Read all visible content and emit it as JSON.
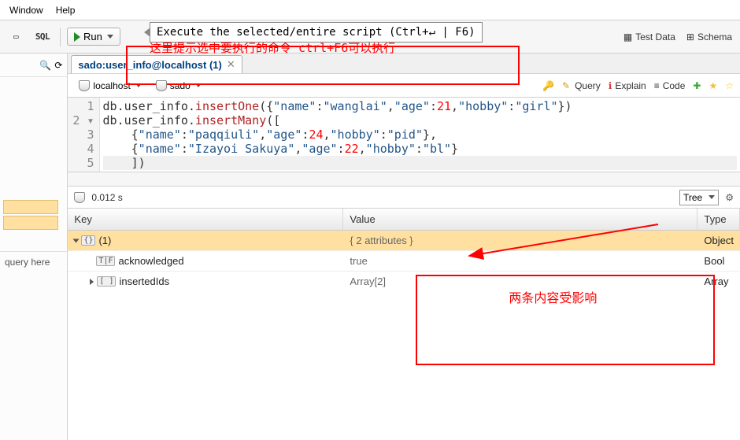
{
  "menu": {
    "window": "Window",
    "help": "Help"
  },
  "toolbar": {
    "run": "Run",
    "tooltip": "Execute the selected/entire script (Ctrl+↵ | F6)",
    "hint_cn": "这里提示选中要执行的命令 ctrl+F6可以执行",
    "test_data": "Test Data",
    "schema": "Schema"
  },
  "tab": {
    "title": "sado:user_info@localhost (1)"
  },
  "conn": {
    "host": "localhost",
    "db": "sado",
    "query": "Query",
    "explain": "Explain",
    "code": "Code"
  },
  "editor": {
    "l1": "db.user_info.insertOne({\"name\":\"wanglai\",\"age\":21,\"hobby\":\"girl\"})",
    "l2a": "db.user_info.insertMany([",
    "l3": "    {\"name\":\"paqqiuli\",\"age\":24,\"hobby\":\"pid\"},",
    "l4": "    {\"name\":\"Izayoi Sakuya\",\"age\":22,\"hobby\":\"bl\"}",
    "l5": "    ])"
  },
  "result": {
    "time": "0.012 s",
    "view": "Tree",
    "headers": {
      "key": "Key",
      "value": "Value",
      "type": "Type"
    },
    "rows": [
      {
        "key": "(1)",
        "value": "{ 2 attributes }",
        "type": "Object"
      },
      {
        "key": "acknowledged",
        "value": "true",
        "type": "Bool"
      },
      {
        "key": "insertedIds",
        "value": "Array[2]",
        "type": "Array"
      }
    ],
    "hint_cn": "两条内容受影响"
  },
  "left": {
    "query_hint": "query here"
  }
}
